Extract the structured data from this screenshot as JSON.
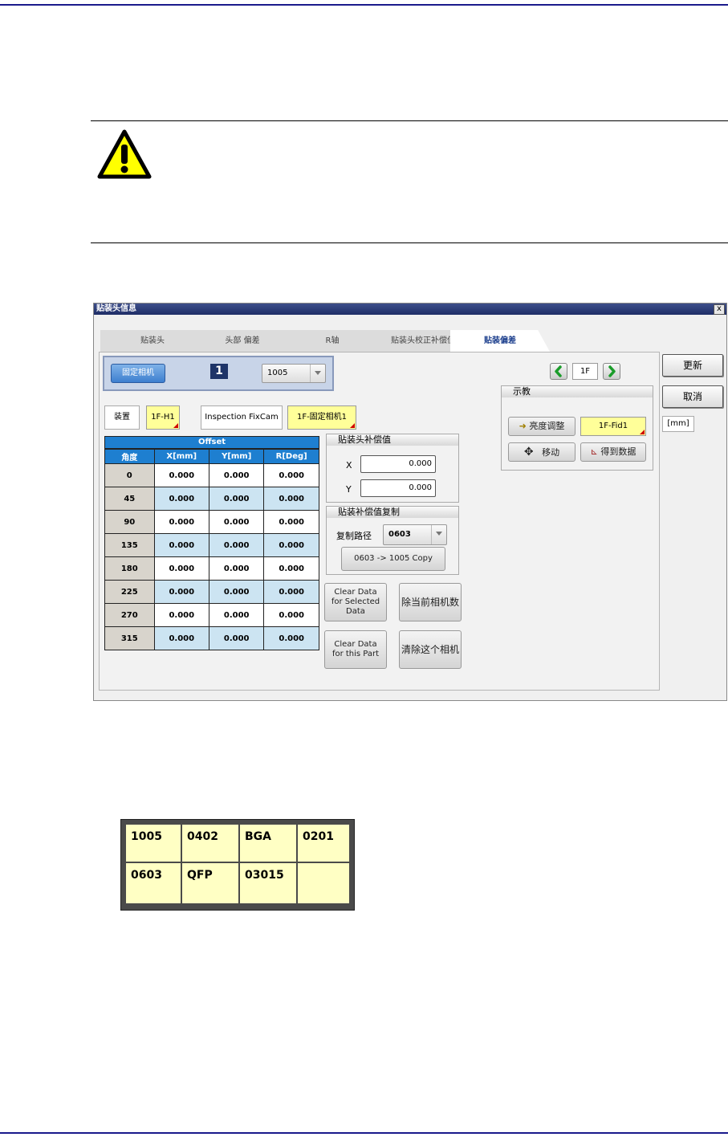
{
  "window": {
    "title": "贴装头信息",
    "close": "x"
  },
  "tabs": [
    {
      "label": "贴装头"
    },
    {
      "label": "头部 偏差"
    },
    {
      "label": "R轴"
    },
    {
      "label": "贴装头校正补偿值"
    },
    {
      "label": "贴装偏差"
    }
  ],
  "camera": {
    "button_label": "固定相机",
    "number": "1",
    "part_select": "1005"
  },
  "device": {
    "label": "装置",
    "head_value": "1F-H1",
    "inspection_label": "Inspection FixCam",
    "camera_value": "1F-固定相机1"
  },
  "offset_table": {
    "title": "Offset",
    "columns": [
      "角度",
      "X[mm]",
      "Y[mm]",
      "R[Deg]"
    ],
    "rows": [
      [
        "0",
        "0.000",
        "0.000",
        "0.000"
      ],
      [
        "45",
        "0.000",
        "0.000",
        "0.000"
      ],
      [
        "90",
        "0.000",
        "0.000",
        "0.000"
      ],
      [
        "135",
        "0.000",
        "0.000",
        "0.000"
      ],
      [
        "180",
        "0.000",
        "0.000",
        "0.000"
      ],
      [
        "225",
        "0.000",
        "0.000",
        "0.000"
      ],
      [
        "270",
        "0.000",
        "0.000",
        "0.000"
      ],
      [
        "315",
        "0.000",
        "0.000",
        "0.000"
      ]
    ]
  },
  "head_comp": {
    "title": "贴装头补偿值",
    "x_label": "X",
    "x_value": "0.000",
    "y_label": "Y",
    "y_value": "0.000"
  },
  "comp_copy": {
    "title": "贴装补偿值复制",
    "path_label": "复制路径",
    "path_value": "0603",
    "copy_button": "0603 -> 1005 Copy"
  },
  "actions": {
    "clear_selected": "Clear Data for Selected Data",
    "clear_current_camera": "除当前相机数",
    "clear_part": "Clear Data for this Part",
    "clear_this_camera": "清除这个相机"
  },
  "nav": {
    "floor": "1F"
  },
  "teach": {
    "title": "示教",
    "brightness_button": "亮度调整",
    "fid_value": "1F-Fid1",
    "move_button": "移动",
    "get_data_button": "得到数据"
  },
  "side": {
    "update_button": "更新",
    "cancel_button": "取消",
    "unit": "[mm]"
  },
  "parts_grid": [
    [
      "1005",
      "0402",
      "BGA",
      "0201"
    ],
    [
      "0603",
      "QFP",
      "03015",
      ""
    ]
  ],
  "colors": {
    "page_rule": "#1a1a8c",
    "title_bar": "#1e2d66",
    "grid_header": "#1e7fd0",
    "cell_blue": "#cce4f2",
    "highlight_yellow": "#ffff99"
  }
}
